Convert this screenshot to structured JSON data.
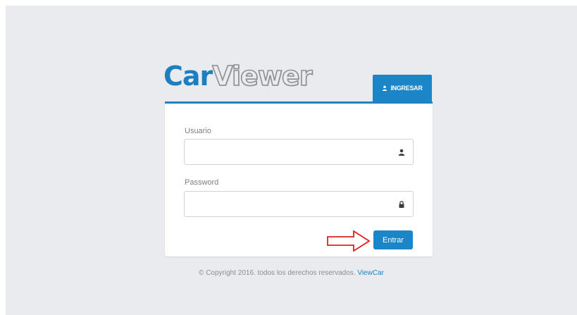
{
  "brand": {
    "part1": "Car",
    "part2": "Viewer"
  },
  "tab": {
    "label": "INGRESAR",
    "icon": "user-icon"
  },
  "form": {
    "username_label": "Usuario",
    "username_value": "",
    "username_icon": "user-icon",
    "password_label": "Password",
    "password_value": "",
    "password_icon": "lock-icon",
    "submit_label": "Entrar"
  },
  "annotation": {
    "icon": "red-arrow-right",
    "color": "#e0201b"
  },
  "footer": {
    "text": "© Copyright 2016. todos los derechos reservados.",
    "link": "ViewCar"
  },
  "colors": {
    "accent": "#1a86c8",
    "background": "#e9ebef"
  }
}
